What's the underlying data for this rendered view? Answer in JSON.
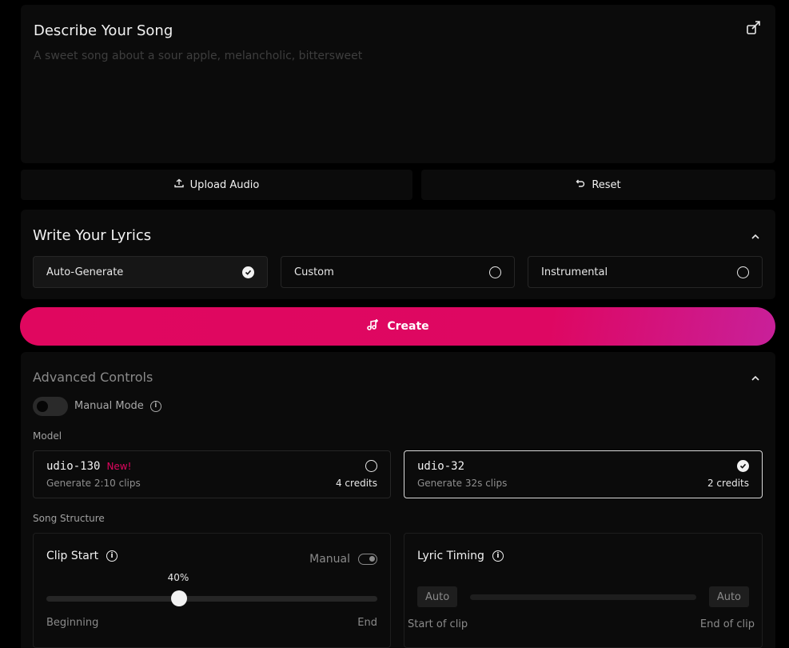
{
  "describe": {
    "title": "Describe Your Song",
    "placeholder": "A sweet song about a sour apple, melancholic, bittersweet",
    "expand_icon": "external-expand-icon"
  },
  "actions": {
    "upload_label": "Upload Audio",
    "upload_icon": "upload-icon",
    "reset_label": "Reset",
    "reset_icon": "undo-icon"
  },
  "lyrics": {
    "title": "Write Your Lyrics",
    "options": [
      {
        "label": "Auto-Generate",
        "selected": true
      },
      {
        "label": "Custom",
        "selected": false
      },
      {
        "label": "Instrumental",
        "selected": false
      }
    ]
  },
  "create": {
    "label": "Create",
    "icon": "music-sparkle-icon",
    "colors": {
      "start": "#e0075f",
      "end": "#c8209a"
    }
  },
  "advanced": {
    "title": "Advanced Controls",
    "manual_mode_label": "Manual Mode",
    "manual_mode_on": false,
    "model_label": "Model",
    "models": [
      {
        "name": "udio-130",
        "badge": "New!",
        "description": "Generate 2:10 clips",
        "credits": "4 credits",
        "selected": false
      },
      {
        "name": "udio-32",
        "badge": "",
        "description": "Generate 32s clips",
        "credits": "2 credits",
        "selected": true
      }
    ],
    "song_structure_label": "Song Structure",
    "clip_start": {
      "label": "Clip Start",
      "manual_label": "Manual",
      "value_label": "40%",
      "value": 0.4,
      "min_label": "Beginning",
      "max_label": "End"
    },
    "lyric_timing": {
      "label": "Lyric Timing",
      "left_auto": "Auto",
      "right_auto": "Auto",
      "min_label": "Start of clip",
      "max_label": "End of clip"
    }
  }
}
